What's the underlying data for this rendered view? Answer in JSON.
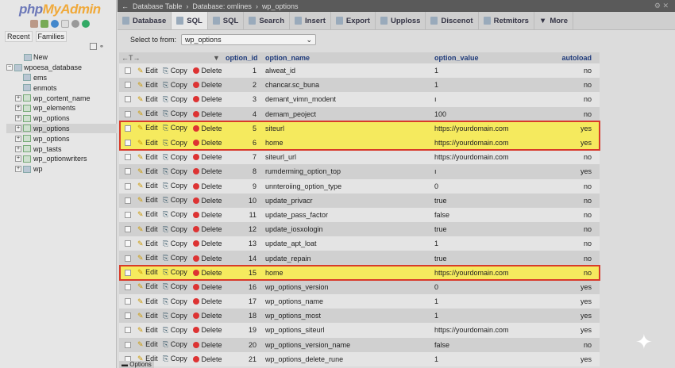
{
  "sidebar": {
    "logo": {
      "php": "php",
      "myadmin": "MyAdmin"
    },
    "tabs": [
      "Recent",
      "Families"
    ],
    "tree": [
      {
        "label": "New",
        "type": "new"
      },
      {
        "label": "wpoesa_database",
        "type": "db"
      },
      {
        "label": "ems",
        "type": "table"
      },
      {
        "label": "enmots",
        "type": "table"
      },
      {
        "label": "wp_cortent_name",
        "type": "view"
      },
      {
        "label": "wp_elements",
        "type": "view"
      },
      {
        "label": "wp_options",
        "type": "view"
      },
      {
        "label": "wp_options",
        "type": "view",
        "selected": true
      },
      {
        "label": "wp_options",
        "type": "view"
      },
      {
        "label": "wp_tasts",
        "type": "view"
      },
      {
        "label": "wp_optionwriters",
        "type": "view"
      },
      {
        "label": "wp",
        "type": "db"
      }
    ]
  },
  "breadcrumb": [
    "Database Table",
    "Database: omlines",
    "wp_options"
  ],
  "tabs": [
    {
      "label": "Database"
    },
    {
      "label": "SQL",
      "active": true
    },
    {
      "label": "SQL"
    },
    {
      "label": "Search"
    },
    {
      "label": "Insert"
    },
    {
      "label": "Export"
    },
    {
      "label": "Upploss"
    },
    {
      "label": "Discenot"
    },
    {
      "label": "Retmitors"
    },
    {
      "label": "More"
    }
  ],
  "select": {
    "label": "Select to from:",
    "value": "wp_options"
  },
  "table": {
    "nav": "←T→",
    "headers": [
      "option_id",
      "option_name",
      "option_value",
      "autoload"
    ],
    "actions": {
      "edit": "Edit",
      "copy": "Copy",
      "delete": "Delete"
    },
    "rows": [
      [
        "1",
        "alweat_id",
        "1",
        "no"
      ],
      [
        "2",
        "chancar.sc_buna",
        "1",
        "no"
      ],
      [
        "3",
        "demant_vimn_modent",
        "ı",
        "no"
      ],
      [
        "4",
        "demam_peoject",
        "100",
        "no"
      ],
      [
        "5",
        "siteurl",
        "https://yourdomain.com",
        "yes"
      ],
      [
        "6",
        "home",
        "https://yourdomain.com",
        "yes"
      ],
      [
        "7",
        "siteurl_url",
        "https://yourdomain.com",
        "no"
      ],
      [
        "8",
        "rumderming_option_top",
        "ı",
        "yes"
      ],
      [
        "9",
        "unnteroiing_option_type",
        "0",
        "no"
      ],
      [
        "10",
        "update_privacr",
        "true",
        "no"
      ],
      [
        "11",
        "update_pass_factor",
        "false",
        "no"
      ],
      [
        "12",
        "update_iosxologin",
        "true",
        "no"
      ],
      [
        "13",
        "update_apt_loat",
        "1",
        "no"
      ],
      [
        "14",
        "update_repain",
        "true",
        "no"
      ],
      [
        "15",
        "home",
        "https://yourdomain.com",
        "no"
      ],
      [
        "16",
        "wp_options_version",
        "0",
        "yes"
      ],
      [
        "17",
        "wp_options_name",
        "1",
        "yes"
      ],
      [
        "18",
        "wp_options_most",
        "1",
        "yes"
      ],
      [
        "19",
        "wp_options_siteurl",
        "https://yourdomain.com",
        "yes"
      ],
      [
        "20",
        "wp_options_version_name",
        "false",
        "no"
      ],
      [
        "21",
        "wp_options_delete_rune",
        "1",
        "yes"
      ]
    ],
    "highlighted_ids": [
      "5",
      "6",
      "15"
    ],
    "highlight_color": "#f5ea5e",
    "outline_color": "#d83a2a"
  },
  "footer": {
    "options": "Options"
  }
}
